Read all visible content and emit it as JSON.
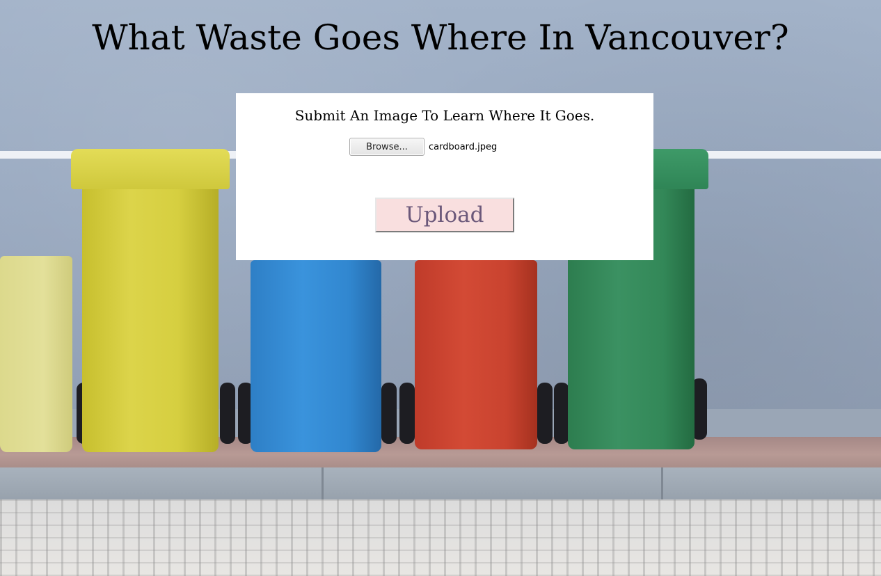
{
  "page": {
    "title": "What Waste Goes Where In Vancouver?"
  },
  "form": {
    "subtitle": "Submit An Image To Learn Where It Goes.",
    "browse_label": "Browse...",
    "selected_file": "cardboard.jpeg",
    "upload_label": "Upload"
  },
  "colors": {
    "card_background": "#ffffff",
    "upload_background": "#f9dfdf",
    "upload_text": "#6b587a",
    "bin_yellow": "#d6cf40",
    "bin_blue": "#3a93dc",
    "bin_red": "#d34a35",
    "bin_green": "#3b9162"
  }
}
